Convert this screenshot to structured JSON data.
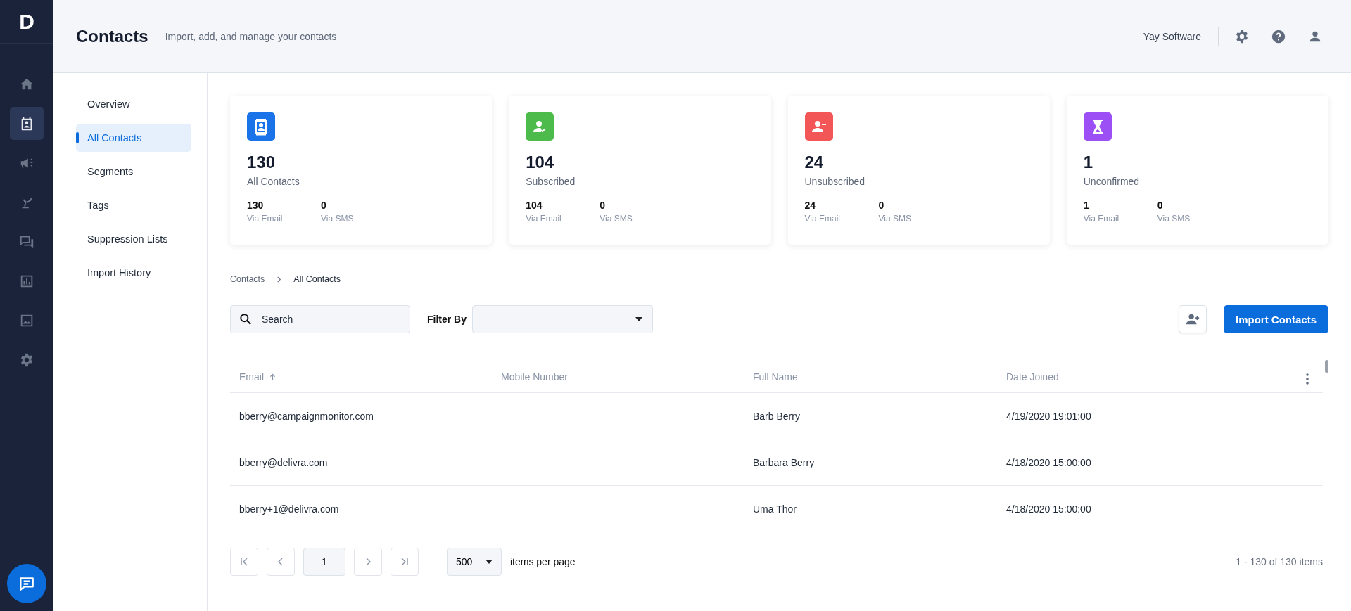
{
  "logo": "D",
  "rail": [
    {
      "kind": "home",
      "selected": false
    },
    {
      "kind": "contacts",
      "selected": true
    },
    {
      "kind": "megaphone",
      "selected": false
    },
    {
      "kind": "robot",
      "selected": false
    },
    {
      "kind": "chat",
      "selected": false
    },
    {
      "kind": "chart",
      "selected": false
    },
    {
      "kind": "image",
      "selected": false
    },
    {
      "kind": "gear",
      "selected": false
    }
  ],
  "header": {
    "title": "Contacts",
    "subtitle": "Import, add, and manage your contacts",
    "account": "Yay Software"
  },
  "subnav": [
    {
      "label": "Overview",
      "selected": false
    },
    {
      "label": "All Contacts",
      "selected": true
    },
    {
      "label": "Segments",
      "selected": false
    },
    {
      "label": "Tags",
      "selected": false
    },
    {
      "label": "Suppression Lists",
      "selected": false
    },
    {
      "label": "Import History",
      "selected": false
    }
  ],
  "cards": [
    {
      "kind": "contacts",
      "color": "#1a73e8",
      "count": "130",
      "label": "All Contacts",
      "stats": [
        {
          "value": "130",
          "label": "Via Email"
        },
        {
          "value": "0",
          "label": "Via SMS"
        }
      ]
    },
    {
      "kind": "subscribed",
      "color": "#4cbb4c",
      "count": "104",
      "label": "Subscribed",
      "stats": [
        {
          "value": "104",
          "label": "Via Email"
        },
        {
          "value": "0",
          "label": "Via SMS"
        }
      ]
    },
    {
      "kind": "unsubscribed",
      "color": "#f25656",
      "count": "24",
      "label": "Unsubscribed",
      "stats": [
        {
          "value": "24",
          "label": "Via Email"
        },
        {
          "value": "0",
          "label": "Via SMS"
        }
      ]
    },
    {
      "kind": "unconfirmed",
      "color": "#9b4ff5",
      "count": "1",
      "label": "Unconfirmed",
      "stats": [
        {
          "value": "1",
          "label": "Via Email"
        },
        {
          "value": "0",
          "label": "Via SMS"
        }
      ]
    }
  ],
  "breadcrumb": [
    "Contacts",
    "All Contacts"
  ],
  "search": {
    "placeholder": "Search"
  },
  "filter": {
    "label": "Filter By"
  },
  "import_button": "Import Contacts",
  "table": {
    "columns": [
      {
        "label": "Email",
        "sorted": true
      },
      {
        "label": "Mobile Number",
        "sorted": false
      },
      {
        "label": "Full Name",
        "sorted": false
      },
      {
        "label": "Date Joined",
        "sorted": false
      }
    ],
    "rows": [
      [
        "bberry@campaignmonitor.com",
        "",
        "Barb Berry",
        "4/19/2020 19:01:00"
      ],
      [
        "bberry@delivra.com",
        "",
        "Barbara Berry",
        "4/18/2020 15:00:00"
      ],
      [
        "bberry+1@delivra.com",
        "",
        "Uma Thor",
        "4/18/2020 15:00:00"
      ]
    ]
  },
  "pagination": {
    "page": "1",
    "page_size": "500",
    "page_size_label": "items per page",
    "summary": "1 - 130 of 130 items"
  }
}
